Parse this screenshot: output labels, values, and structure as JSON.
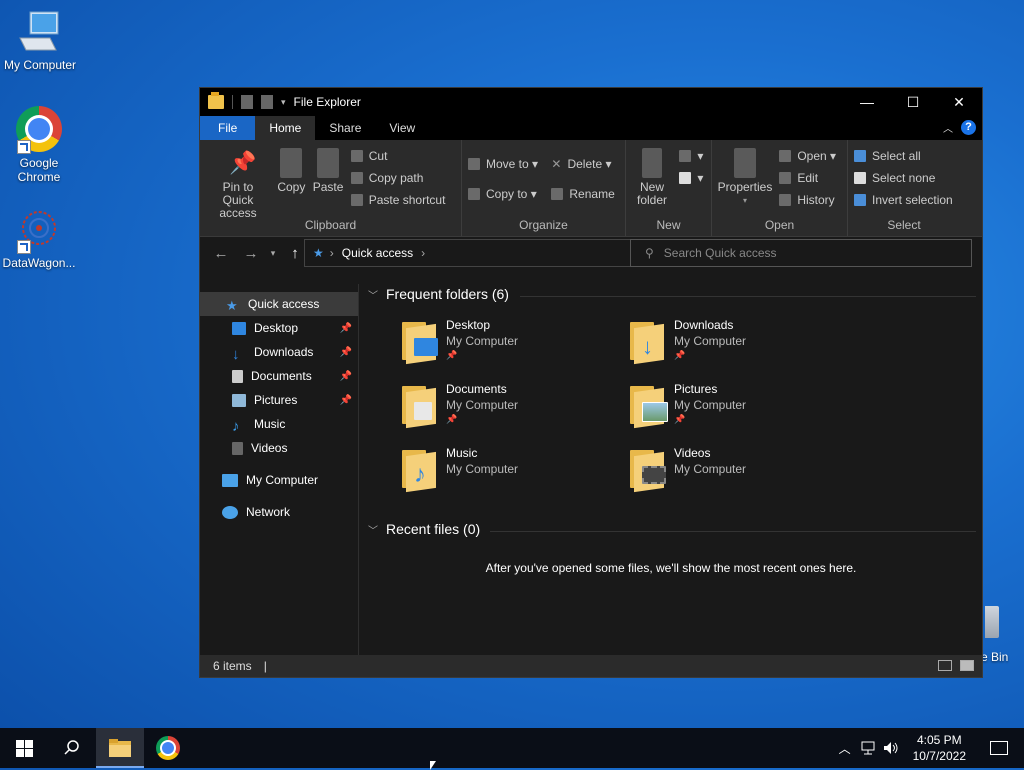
{
  "desktop": {
    "icons": [
      {
        "label": "My Computer"
      },
      {
        "label": "Google Chrome"
      },
      {
        "label": "DataWagon..."
      }
    ],
    "recycle_bin_partial_label": "e Bin"
  },
  "window": {
    "title": "File Explorer",
    "controls": {
      "minimize": "—",
      "maximize": "☐",
      "close": "✕"
    },
    "tabs": [
      "File",
      "Home",
      "Share",
      "View"
    ],
    "active_tab": "Home",
    "help": "?",
    "ribbon": {
      "clipboard": {
        "label": "Clipboard",
        "pin": "Pin to Quick access",
        "copy": "Copy",
        "paste": "Paste",
        "cut": "Cut",
        "copy_path": "Copy path",
        "paste_shortcut": "Paste shortcut"
      },
      "organize": {
        "label": "Organize",
        "move_to": "Move to",
        "copy_to": "Copy to",
        "delete": "Delete",
        "rename": "Rename"
      },
      "new": {
        "label": "New",
        "new_folder": "New folder"
      },
      "open": {
        "label": "Open",
        "properties": "Properties",
        "open": "Open",
        "edit": "Edit",
        "history": "History"
      },
      "select": {
        "label": "Select",
        "select_all": "Select all",
        "select_none": "Select none",
        "invert": "Invert selection"
      }
    },
    "address": {
      "location": "Quick access",
      "search_placeholder": "Search Quick access"
    },
    "sidebar": {
      "items": [
        {
          "label": "Quick access",
          "pinned": false
        },
        {
          "label": "Desktop",
          "pinned": true
        },
        {
          "label": "Downloads",
          "pinned": true
        },
        {
          "label": "Documents",
          "pinned": true
        },
        {
          "label": "Pictures",
          "pinned": true
        },
        {
          "label": "Music",
          "pinned": false
        },
        {
          "label": "Videos",
          "pinned": false
        },
        {
          "label": "My Computer",
          "pinned": false
        },
        {
          "label": "Network",
          "pinned": false
        }
      ]
    },
    "content": {
      "frequent_header": "Frequent folders (6)",
      "folders": [
        {
          "name": "Desktop",
          "location": "My Computer",
          "pinned": true
        },
        {
          "name": "Downloads",
          "location": "My Computer",
          "pinned": true
        },
        {
          "name": "Documents",
          "location": "My Computer",
          "pinned": true
        },
        {
          "name": "Pictures",
          "location": "My Computer",
          "pinned": true
        },
        {
          "name": "Music",
          "location": "My Computer",
          "pinned": false
        },
        {
          "name": "Videos",
          "location": "My Computer",
          "pinned": false
        }
      ],
      "recent_header": "Recent files (0)",
      "recent_empty": "After you've opened some files, we'll show the most recent ones here."
    },
    "status": {
      "items": "6 items"
    }
  },
  "taskbar": {
    "time": "4:05 PM",
    "date": "10/7/2022"
  }
}
